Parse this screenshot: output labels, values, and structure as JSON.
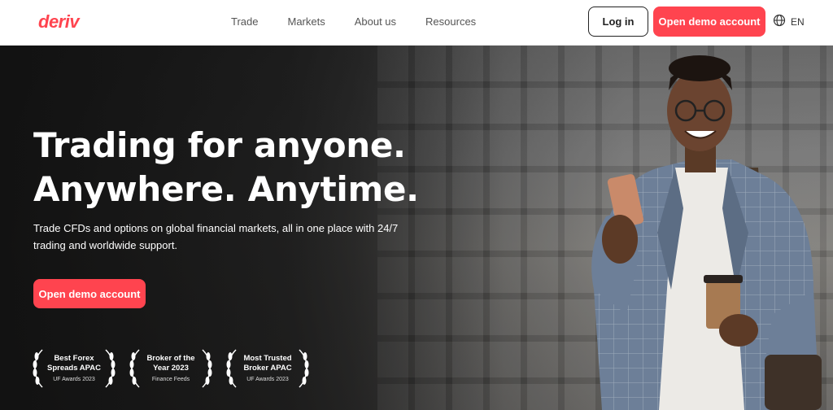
{
  "header": {
    "logo": "deriv",
    "nav": [
      "Trade",
      "Markets",
      "About us",
      "Resources"
    ],
    "login_label": "Log in",
    "demo_label": "Open demo account",
    "language": "EN"
  },
  "hero": {
    "title_line1": "Trading for anyone.",
    "title_line2": "Anywhere. Anytime.",
    "subtitle": "Trade CFDs and options on global financial markets, all in one place with 24/7 trading and worldwide support.",
    "cta_label": "Open demo account"
  },
  "awards": [
    {
      "title_line1": "Best Forex",
      "title_line2": "Spreads APAC",
      "source": "UF Awards 2023"
    },
    {
      "title_line1": "Broker of the",
      "title_line2": "Year 2023",
      "source": "Finance Feeds"
    },
    {
      "title_line1": "Most Trusted",
      "title_line2": "Broker APAC",
      "source": "UF Awards 2023"
    }
  ],
  "colors": {
    "brand": "#ff444f",
    "text_dark": "#222222"
  },
  "icons": {
    "language": "globe-icon",
    "award": "laurel-icon"
  }
}
